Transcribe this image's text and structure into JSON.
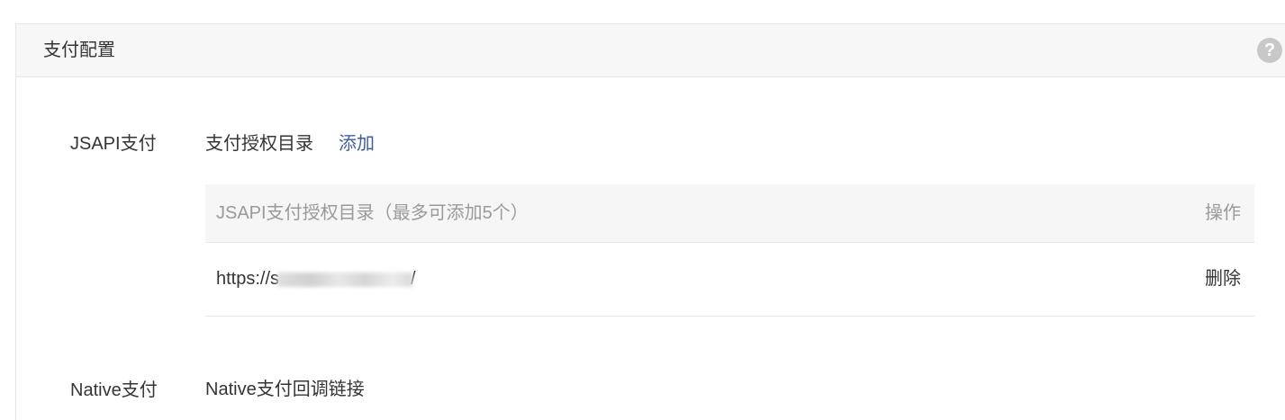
{
  "panel": {
    "title": "支付配置",
    "help_icon": "question-circle-icon"
  },
  "jsapi": {
    "label": "JSAPI支付",
    "subtitle": "支付授权目录",
    "add_link": "添加",
    "table": {
      "headers": [
        "JSAPI支付授权目录（最多可添加5个）",
        "操作"
      ],
      "rows": [
        {
          "url_prefix": "https://s",
          "url_suffix": "/",
          "action": "删除"
        }
      ]
    }
  },
  "native": {
    "label": "Native支付",
    "subtitle": "Native支付回调链接"
  },
  "colors": {
    "link": "#3f5e9c",
    "header_bg": "#f7f7f7",
    "border": "#e7e7eb",
    "muted_text": "#9a9a9a"
  }
}
